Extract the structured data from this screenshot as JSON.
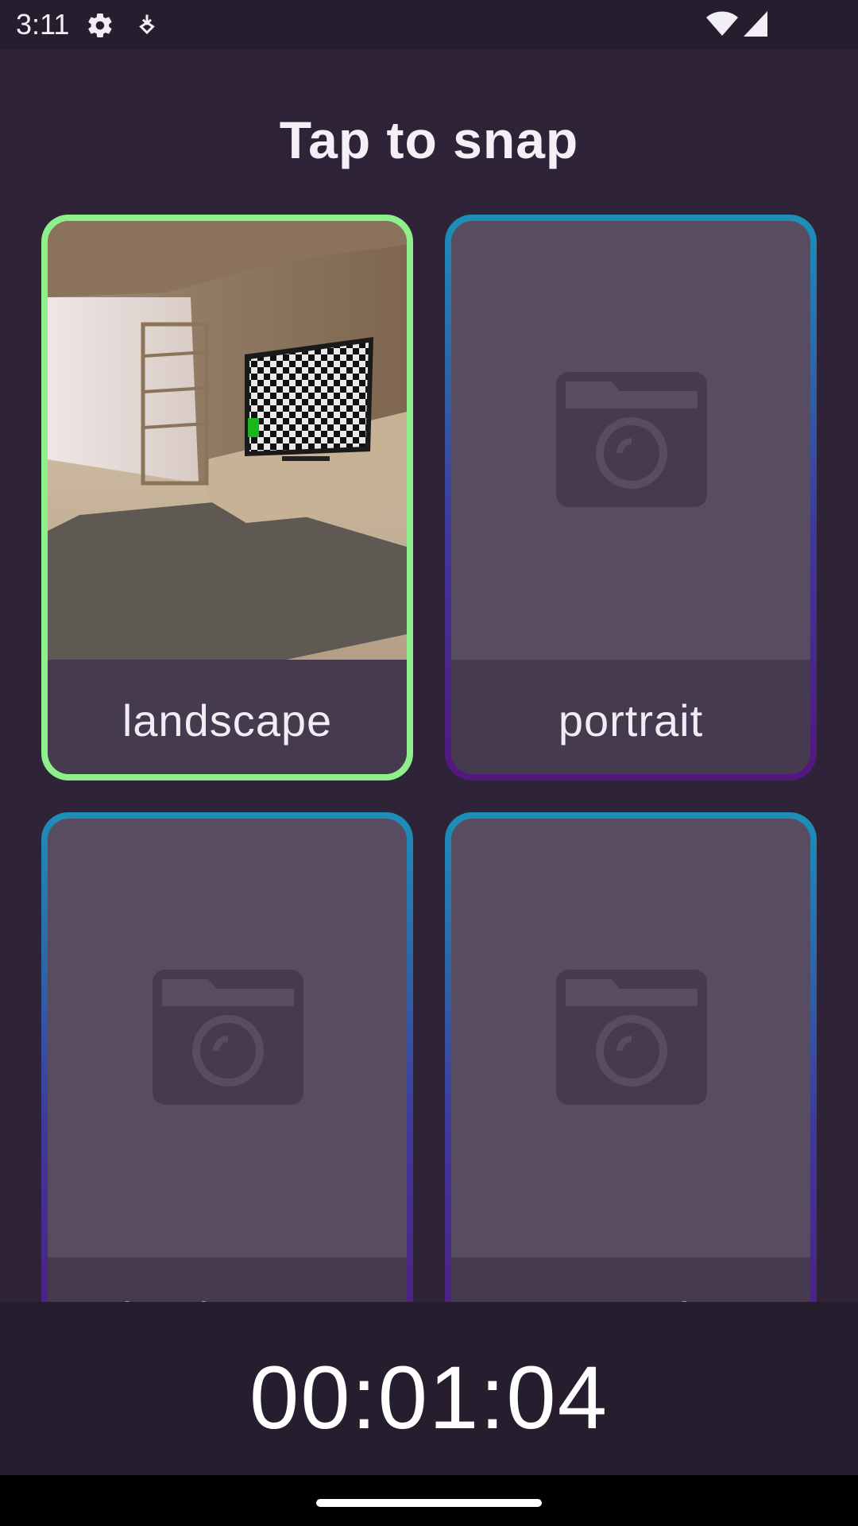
{
  "status_bar": {
    "time": "3:11",
    "icons": [
      "gear-icon",
      "download-icon",
      "wifi-icon",
      "cell-signal-icon"
    ]
  },
  "header": {
    "title": "Tap to snap"
  },
  "cards": [
    {
      "label": "landscape",
      "state": "captured"
    },
    {
      "label": "portrait",
      "state": "empty"
    },
    {
      "label": "landscape",
      "state": "empty"
    },
    {
      "label": "portrait",
      "state": "empty"
    }
  ],
  "timer": {
    "value": "00:01:04"
  },
  "colors": {
    "background": "#2e2337",
    "status_bar": "#261d2e",
    "selected_border": "#8ef08a",
    "border_gradient_top": "#1d8fb8",
    "border_gradient_bottom": "#52177e",
    "card_fill": "#584d60",
    "label_fill": "#453a4e",
    "camera_icon": "#463a4d"
  }
}
